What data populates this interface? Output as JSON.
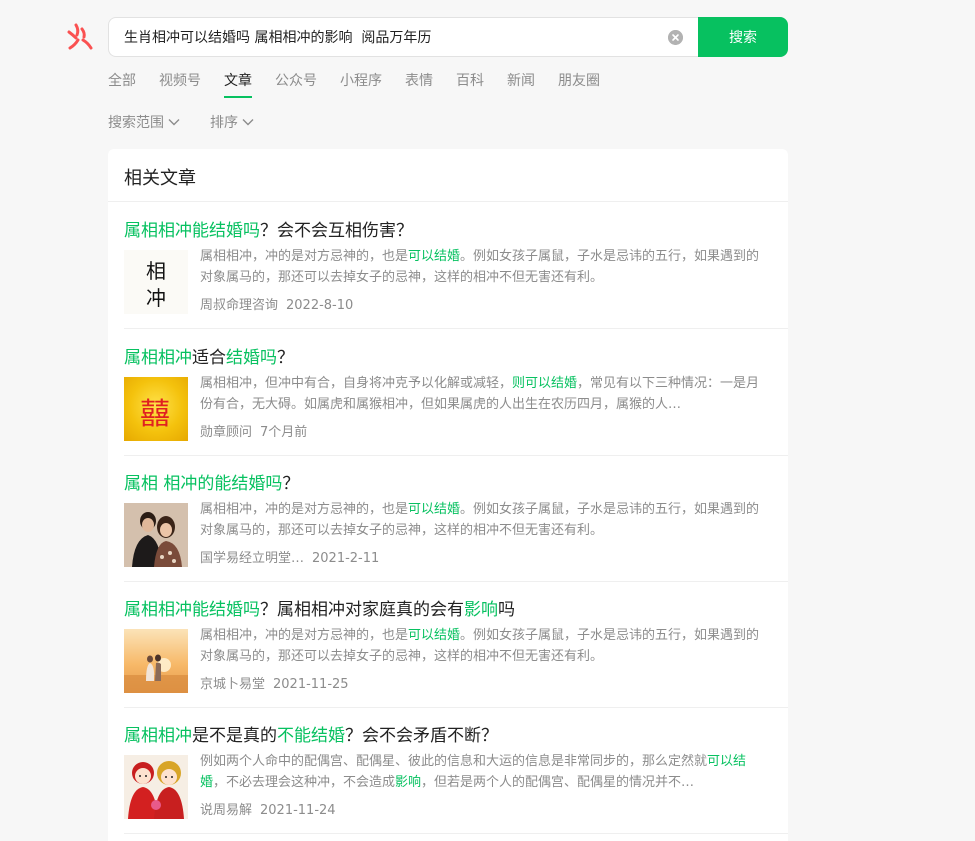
{
  "search": {
    "query": "生肖相冲可以结婚吗 属相相冲的影响  阅品万年历",
    "button_label": "搜索"
  },
  "tabs": [
    {
      "label": "全部",
      "active": false
    },
    {
      "label": "视频号",
      "active": false
    },
    {
      "label": "文章",
      "active": true
    },
    {
      "label": "公众号",
      "active": false
    },
    {
      "label": "小程序",
      "active": false
    },
    {
      "label": "表情",
      "active": false
    },
    {
      "label": "百科",
      "active": false
    },
    {
      "label": "新闻",
      "active": false
    },
    {
      "label": "朋友圈",
      "active": false
    }
  ],
  "filters": {
    "range_label": "搜索范围",
    "sort_label": "排序"
  },
  "section": {
    "title": "相关文章"
  },
  "thumbs": {
    "thumb1_text_top": "相",
    "thumb1_text_bottom": "冲",
    "thumb2_text": "囍"
  },
  "articles": [
    {
      "title_parts": [
        {
          "text": "属相相冲能结婚吗",
          "hl": true
        },
        {
          "text": "？会不会互相伤害？",
          "hl": false
        }
      ],
      "summary_parts": [
        {
          "text": "属相相冲，冲的是对方忌神的，也是",
          "hl": false
        },
        {
          "text": "可以结婚",
          "hl": true
        },
        {
          "text": "。例如女孩子属鼠，子水是忌讳的五行，如果遇到的对象属马的，那还可以去掉女子的忌神，这样的相冲不但无害还有利。",
          "hl": false
        }
      ],
      "source": "周叔命理咨询",
      "date": "2022-8-10"
    },
    {
      "title_parts": [
        {
          "text": "属相相冲",
          "hl": true
        },
        {
          "text": "适合",
          "hl": false
        },
        {
          "text": "结婚吗",
          "hl": true
        },
        {
          "text": "？",
          "hl": false
        }
      ],
      "summary_parts": [
        {
          "text": "属相相冲，但冲中有合，自身将冲克予以化解或减轻，",
          "hl": false
        },
        {
          "text": "则可以结婚",
          "hl": true
        },
        {
          "text": "，常见有以下三种情况：一是月份有合，无大碍。如属虎和属猴相冲，但如果属虎的人出生在农历四月，属猴的人…",
          "hl": false
        }
      ],
      "source": "勋章顾问",
      "date": "7个月前"
    },
    {
      "title_parts": [
        {
          "text": "属相 相冲的能结婚吗",
          "hl": true
        },
        {
          "text": "？",
          "hl": false
        }
      ],
      "summary_parts": [
        {
          "text": "属相相冲，冲的是对方忌神的，也是",
          "hl": false
        },
        {
          "text": "可以结婚",
          "hl": true
        },
        {
          "text": "。例如女孩子属鼠，子水是忌讳的五行，如果遇到的对象属马的，那还可以去掉女子的忌神，这样的相冲不但无害还有利。",
          "hl": false
        }
      ],
      "source": "国学易经立明堂…",
      "date": "2021-2-11"
    },
    {
      "title_parts": [
        {
          "text": "属相相冲能结婚吗",
          "hl": true
        },
        {
          "text": "？属相相冲对家庭真的会有",
          "hl": false
        },
        {
          "text": "影响",
          "hl": true
        },
        {
          "text": "吗",
          "hl": false
        }
      ],
      "summary_parts": [
        {
          "text": "属相相冲，冲的是对方忌神的，也是",
          "hl": false
        },
        {
          "text": "可以结婚",
          "hl": true
        },
        {
          "text": "。例如女孩子属鼠，子水是忌讳的五行，如果遇到的对象属马的，那还可以去掉女子的忌神，这样的相冲不但无害还有利。",
          "hl": false
        }
      ],
      "source": "京城卜易堂",
      "date": "2021-11-25"
    },
    {
      "title_parts": [
        {
          "text": "属相相冲",
          "hl": true
        },
        {
          "text": "是不是真的",
          "hl": false
        },
        {
          "text": "不能结婚",
          "hl": true
        },
        {
          "text": "？会不会矛盾不断？",
          "hl": false
        }
      ],
      "summary_parts": [
        {
          "text": "例如两个人命中的配偶宫、配偶星、彼此的信息和大运的信息是非常同步的，那么定然就",
          "hl": false
        },
        {
          "text": "可以结婚",
          "hl": true
        },
        {
          "text": "，不必去理会这种冲，不会造成",
          "hl": false
        },
        {
          "text": "影响",
          "hl": true
        },
        {
          "text": "，但若是两个人的配偶宫、配偶星的情况并不…",
          "hl": false
        }
      ],
      "source": "说周易解",
      "date": "2021-11-24"
    }
  ]
}
